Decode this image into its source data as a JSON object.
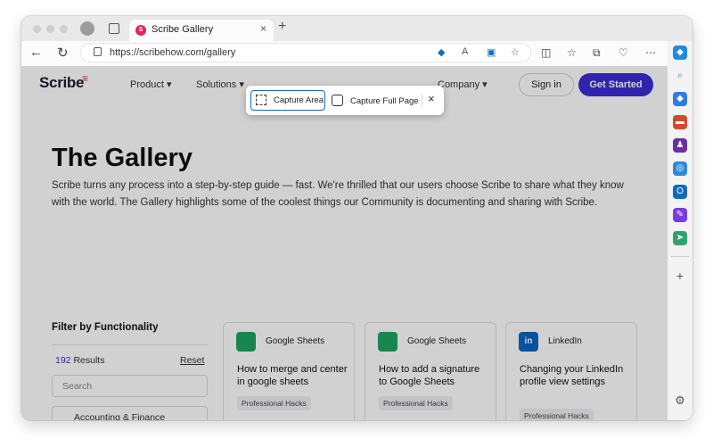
{
  "browser": {
    "tab_title": "Scribe Gallery",
    "tab_favicon": "scribe-favicon",
    "url_prefix": "https://",
    "url_host": "scribehow.com/gallery",
    "new_tab_symbol": "+",
    "close_symbol": "×"
  },
  "site": {
    "logo": "Scribe",
    "nav": [
      "Product",
      "Solutions",
      "Company"
    ],
    "signin": "Sign in",
    "get_started": "Get Started",
    "accent_color": "#3b2dd6"
  },
  "hero": {
    "title": "The Gallery",
    "text": "Scribe turns any process into a step-by-step guide — fast. We're thrilled that our users choose Scribe to share what they know with the world. The Gallery highlights some of the coolest things our Community is documenting and sharing with Scribe."
  },
  "filter": {
    "title": "Filter by Functionality",
    "results_count": "192",
    "results_label": " Results",
    "reset": "Reset",
    "search_placeholder": "Search",
    "next_item": "Accounting & Finance"
  },
  "cards": [
    {
      "source": "Google Sheets",
      "title": "How to merge and center in google sheets",
      "tag": "Professional Hacks",
      "icon": "google-sheets-icon"
    },
    {
      "source": "Google Sheets",
      "title": "How to add a signature to Google Sheets",
      "tag": "Professional Hacks",
      "icon": "google-sheets-icon"
    },
    {
      "source": "LinkedIn",
      "title": "Changing your LinkedIn profile view settings",
      "tag": "Professional Hacks",
      "icon": "linkedin-icon"
    }
  ],
  "capture": {
    "area_label": "Capture Area",
    "full_label": "Capture Full Page"
  }
}
